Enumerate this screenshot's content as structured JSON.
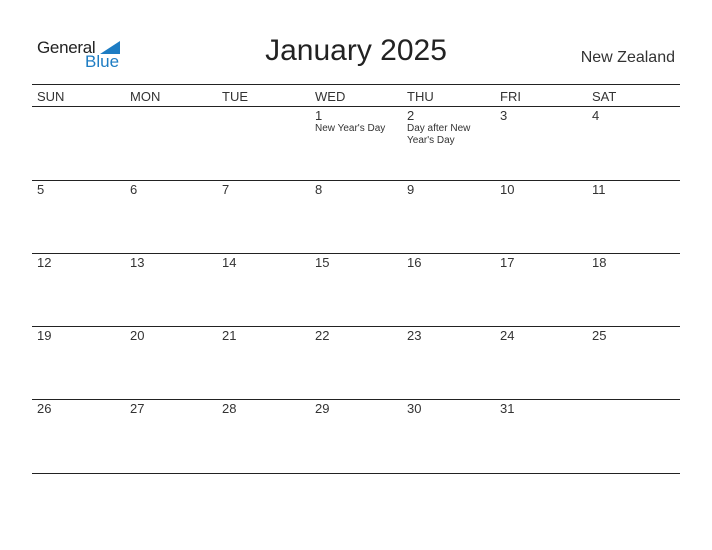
{
  "logo": {
    "line1": "General",
    "line2": "Blue",
    "accent_color": "#1d7cc3"
  },
  "header": {
    "title": "January 2025",
    "country": "New Zealand"
  },
  "weekdays": [
    "SUN",
    "MON",
    "TUE",
    "WED",
    "THU",
    "FRI",
    "SAT"
  ],
  "weeks": [
    [
      {
        "d": ""
      },
      {
        "d": ""
      },
      {
        "d": ""
      },
      {
        "d": "1",
        "h": "New Year's Day"
      },
      {
        "d": "2",
        "h": "Day after New Year's Day"
      },
      {
        "d": "3"
      },
      {
        "d": "4"
      }
    ],
    [
      {
        "d": "5"
      },
      {
        "d": "6"
      },
      {
        "d": "7"
      },
      {
        "d": "8"
      },
      {
        "d": "9"
      },
      {
        "d": "10"
      },
      {
        "d": "11"
      }
    ],
    [
      {
        "d": "12"
      },
      {
        "d": "13"
      },
      {
        "d": "14"
      },
      {
        "d": "15"
      },
      {
        "d": "16"
      },
      {
        "d": "17"
      },
      {
        "d": "18"
      }
    ],
    [
      {
        "d": "19"
      },
      {
        "d": "20"
      },
      {
        "d": "21"
      },
      {
        "d": "22"
      },
      {
        "d": "23"
      },
      {
        "d": "24"
      },
      {
        "d": "25"
      }
    ],
    [
      {
        "d": "26"
      },
      {
        "d": "27"
      },
      {
        "d": "28"
      },
      {
        "d": "29"
      },
      {
        "d": "30"
      },
      {
        "d": "31"
      },
      {
        "d": ""
      }
    ]
  ]
}
